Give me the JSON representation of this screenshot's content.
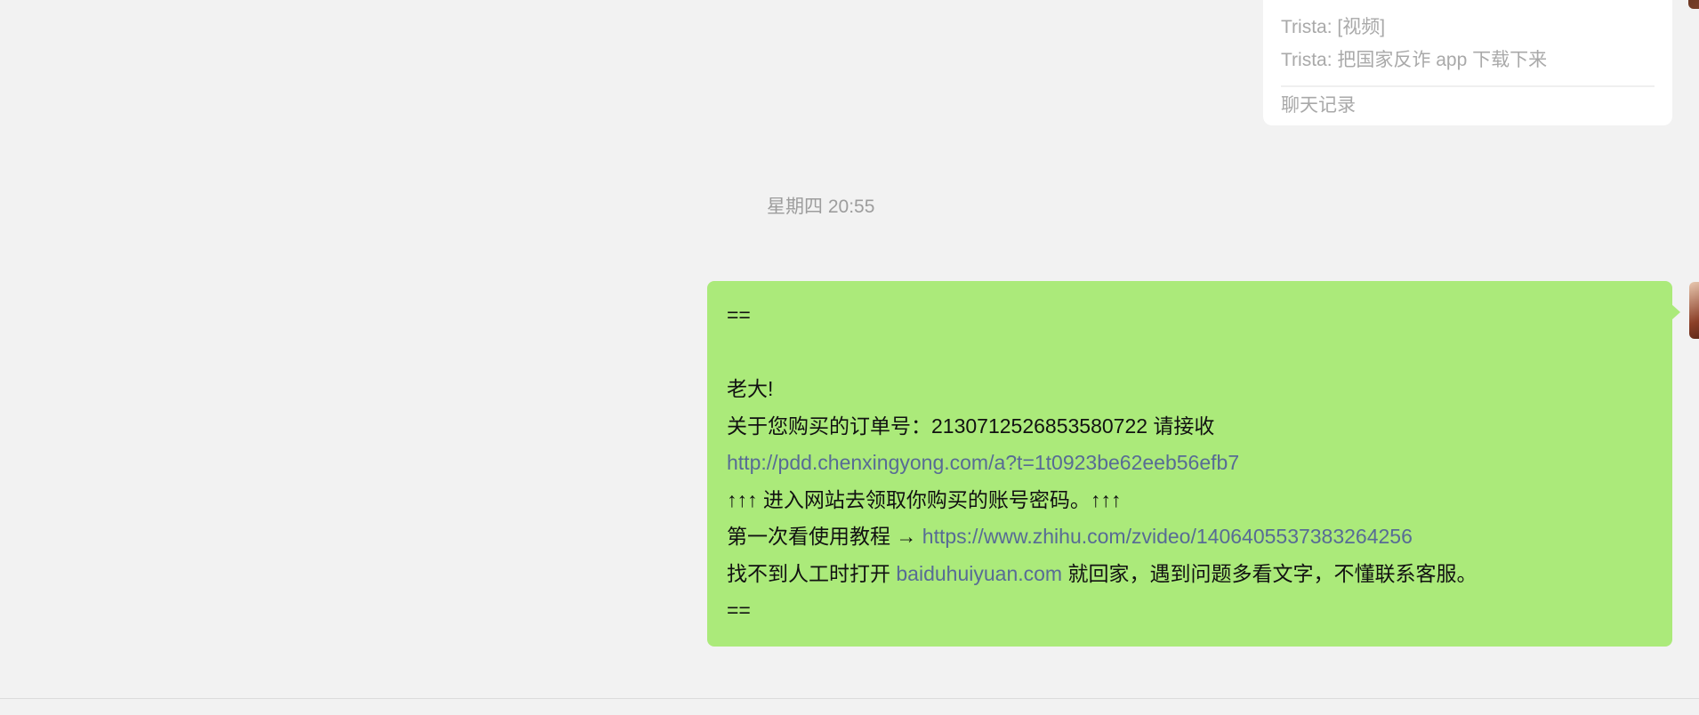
{
  "chat_record_card": {
    "lines": [
      "Trista: [视频]",
      "Trista: 把国家反诈 app 下载下来"
    ],
    "footer": "聊天记录"
  },
  "timestamp": "星期四 20:55",
  "message": {
    "line1": "==",
    "line3": "老大!",
    "line4": "关于您购买的订单号：2130712526853580722 请接收",
    "link1": "http://pdd.chenxingyong.com/a?t=1t0923be62eeb56efb7",
    "line6": "↑↑↑ 进入网站去领取你购买的账号密码。↑↑↑",
    "line7_prefix": "第一次看使用教程 → ",
    "link2": "https://www.zhihu.com/zvideo/1406405537383264256",
    "line8_prefix": "找不到人工时打开 ",
    "link3": "baiduhuiyuan.com",
    "line8_suffix": " 就回家，遇到问题多看文字，不懂联系客服。",
    "line9": "==",
    "bubble_color": "#abea7a",
    "link_color": "#576b95"
  }
}
